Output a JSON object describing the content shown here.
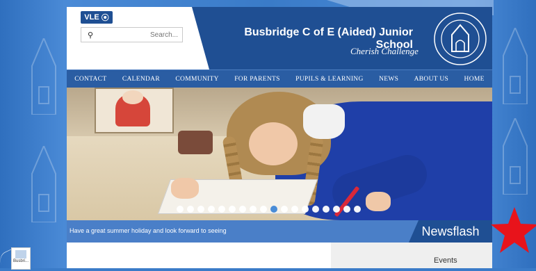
{
  "header": {
    "vle_label": "VLE",
    "school_name": "Busbridge C of E (Aided) Junior School",
    "tagline": "Cherish Challenge"
  },
  "search": {
    "placeholder": "Search..."
  },
  "nav": {
    "items": [
      "HOME",
      "ABOUT US",
      "NEWS",
      "PUPILS & LEARNING",
      "FOR PARENTS",
      "COMMUNITY",
      "CALENDAR",
      "CONTACT"
    ]
  },
  "slider": {
    "dot_count": 18,
    "active_index": 9
  },
  "newsflash": {
    "label": "Newsflash",
    "text": "Have a great summer holiday and look forward to seeing"
  },
  "events": {
    "label": "Events"
  },
  "desktop": {
    "thumb_label": "Busbri..."
  },
  "colors": {
    "brand_blue": "#1f4f93",
    "accent_red": "#e8131b",
    "nav_blue": "#2a5da3"
  },
  "icons": [
    "search-icon",
    "vle-icon",
    "school-crest-icon",
    "star-shape"
  ]
}
